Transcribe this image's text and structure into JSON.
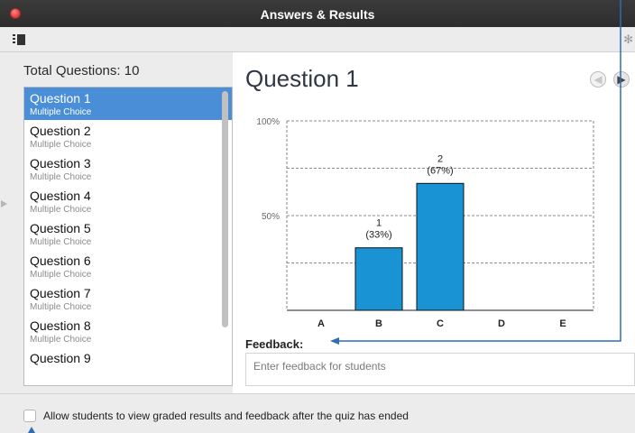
{
  "window": {
    "title": "Answers & Results"
  },
  "toolbar": {
    "right_glyph": "✻"
  },
  "sidebar": {
    "total_label": "Total Questions: 10",
    "questions": [
      {
        "title": "Question 1",
        "type": "Multiple Choice",
        "selected": true
      },
      {
        "title": "Question 2",
        "type": "Multiple Choice"
      },
      {
        "title": "Question 3",
        "type": "Multiple Choice"
      },
      {
        "title": "Question 4",
        "type": "Multiple Choice"
      },
      {
        "title": "Question 5",
        "type": "Multiple Choice"
      },
      {
        "title": "Question 6",
        "type": "Multiple Choice"
      },
      {
        "title": "Question 7",
        "type": "Multiple Choice"
      },
      {
        "title": "Question 8",
        "type": "Multiple Choice"
      },
      {
        "title": "Question 9",
        "type": ""
      }
    ]
  },
  "main": {
    "question_title": "Question 1",
    "nav": {
      "prev": "◀",
      "next": "▶"
    },
    "feedback": {
      "label": "Feedback:",
      "placeholder": "Enter feedback for students"
    }
  },
  "chart_data": {
    "type": "bar",
    "categories": [
      "A",
      "B",
      "C",
      "D",
      "E"
    ],
    "values": [
      0,
      1,
      2,
      0,
      0
    ],
    "percents": [
      0,
      33,
      67,
      0,
      0
    ],
    "labels": [
      "",
      "1\n(33%)",
      "2\n(67%)",
      "",
      ""
    ],
    "ylim": [
      0,
      100
    ],
    "ytick_labels": [
      "50%",
      "100%"
    ],
    "yticks": [
      50,
      100
    ],
    "bar_color": "#1a93d4",
    "grid": true
  },
  "footer": {
    "checkbox_label": "Allow students to view graded results and feedback after the quiz has ended",
    "checked": false
  },
  "colors": {
    "selection": "#4a8ed8",
    "annotation": "#2f6db5"
  }
}
